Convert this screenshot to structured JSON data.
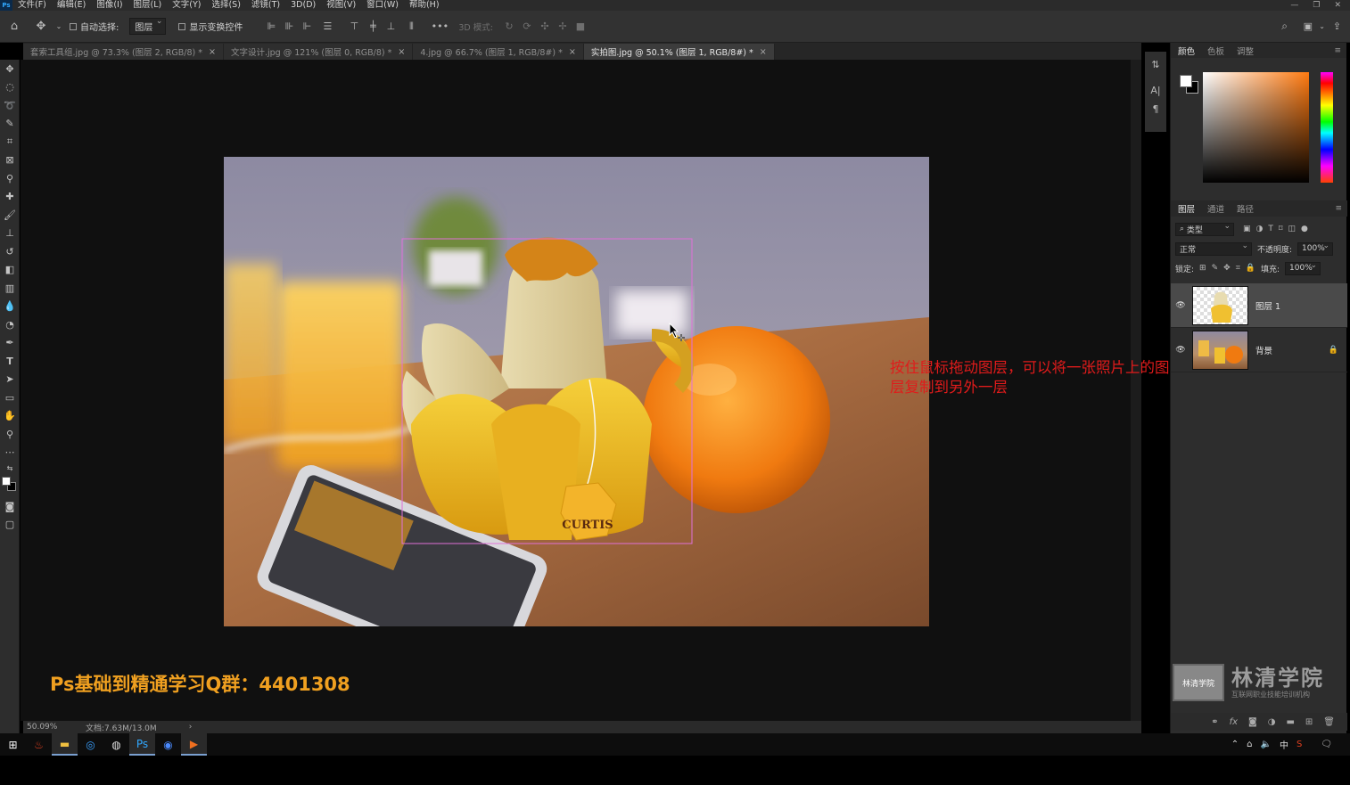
{
  "menu": {
    "items": [
      "文件(F)",
      "编辑(E)",
      "图像(I)",
      "图层(L)",
      "文字(Y)",
      "选择(S)",
      "滤镜(T)",
      "3D(D)",
      "视图(V)",
      "窗口(W)",
      "帮助(H)"
    ],
    "window_controls": [
      "—",
      "❐",
      "✕"
    ]
  },
  "options_bar": {
    "auto_select_label": "自动选择:",
    "auto_select_value": "图层",
    "show_transform_label": "显示变换控件",
    "more_label": "•••",
    "mode_3d_label": "3D 模式:"
  },
  "tabs": [
    {
      "label": "套索工具组.jpg @ 73.3% (图层 2, RGB/8) *",
      "close": "×"
    },
    {
      "label": "文字设计.jpg @ 121% (图层 0, RGB/8) *",
      "close": "×"
    },
    {
      "label": "4.jpg @ 66.7% (图层 1, RGB/8#) *",
      "close": "×"
    },
    {
      "label": "实拍图.jpg @ 50.1% (图层 1, RGB/8#) *",
      "close": "×"
    }
  ],
  "canvas": {
    "annotation": "按住鼠标拖动图层，可以将一张照片上的图层复制到另外一层",
    "promo": "Ps基础到精通学习Q群：4401308",
    "tea_tag_text": "CURTIS"
  },
  "status": {
    "zoom": "50.09%",
    "doc_size": "文档:7.63M/13.0M",
    "arrow": "›"
  },
  "color_panel": {
    "tabs": [
      "颜色",
      "色板",
      "调整"
    ],
    "fg_color": "#ffffff",
    "bg_color": "#000000",
    "picker_hue": "#ff7a10"
  },
  "layers_panel": {
    "tabs": [
      "图层",
      "通道",
      "路径"
    ],
    "filter_label": "类型",
    "blend_mode": "正常",
    "opacity_label": "不透明度:",
    "opacity_value": "100%",
    "lock_label": "锁定:",
    "fill_label": "填充:",
    "fill_value": "100%",
    "layers": [
      {
        "name": "图层 1",
        "selected": true
      },
      {
        "name": "背景",
        "selected": false,
        "locked": true
      }
    ],
    "footer_icons": [
      "link-icon",
      "fx-icon",
      "mask-icon",
      "adjustment-icon",
      "folder-icon",
      "new-layer-icon",
      "trash-icon"
    ]
  },
  "watermark": {
    "seal_text": "林清学院",
    "title": "林清学院",
    "subtitle": "互联网职业技能培训机构"
  },
  "taskbar": {
    "tray_lang": "中"
  }
}
